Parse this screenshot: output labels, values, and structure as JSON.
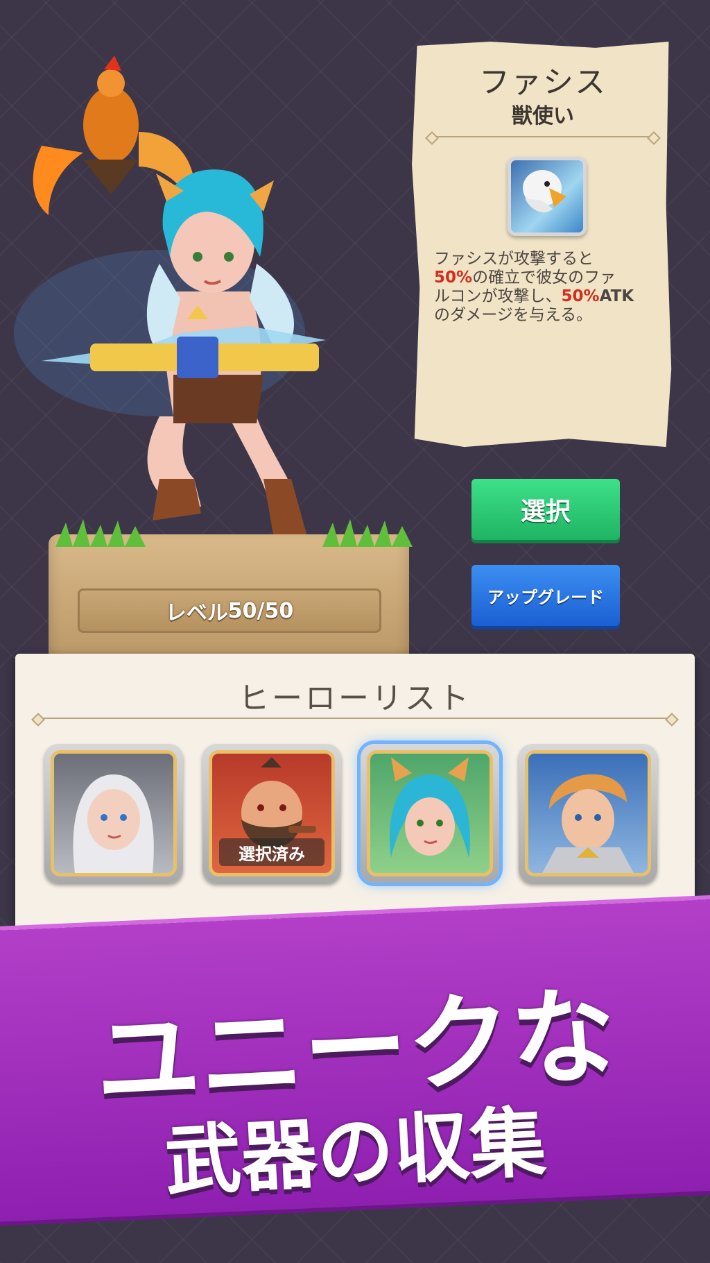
{
  "hero": {
    "name": "ファシス",
    "class": "獣使い",
    "level_label": "レベル",
    "level_value": "50/50",
    "skill": {
      "icon": "falcon-icon",
      "line1": "ファシスが攻撃すると",
      "chance": "50%",
      "line2": "の確立で彼女のファ",
      "line3": "ルコンが攻撃し、",
      "damage": "50%",
      "atk": "ATK",
      "line4": "のダメージを与える。"
    }
  },
  "buttons": {
    "select": "選択",
    "upgrade": "アップグレード"
  },
  "hero_list": {
    "title": "ヒーローリスト",
    "portraits": [
      {
        "name": "silver-haired-heroine",
        "tag": ""
      },
      {
        "name": "bearded-warrior",
        "tag": "選択済み"
      },
      {
        "name": "cat-ear-archer",
        "tag": ""
      },
      {
        "name": "blond-knight",
        "tag": ""
      }
    ]
  },
  "promo": {
    "line1": "ユニークな",
    "line2": "武器の収集"
  },
  "colors": {
    "select_button": "#2ac973",
    "upgrade_button": "#2a76e3",
    "banner": "#a530c0",
    "highlight": "#d32d1e"
  }
}
